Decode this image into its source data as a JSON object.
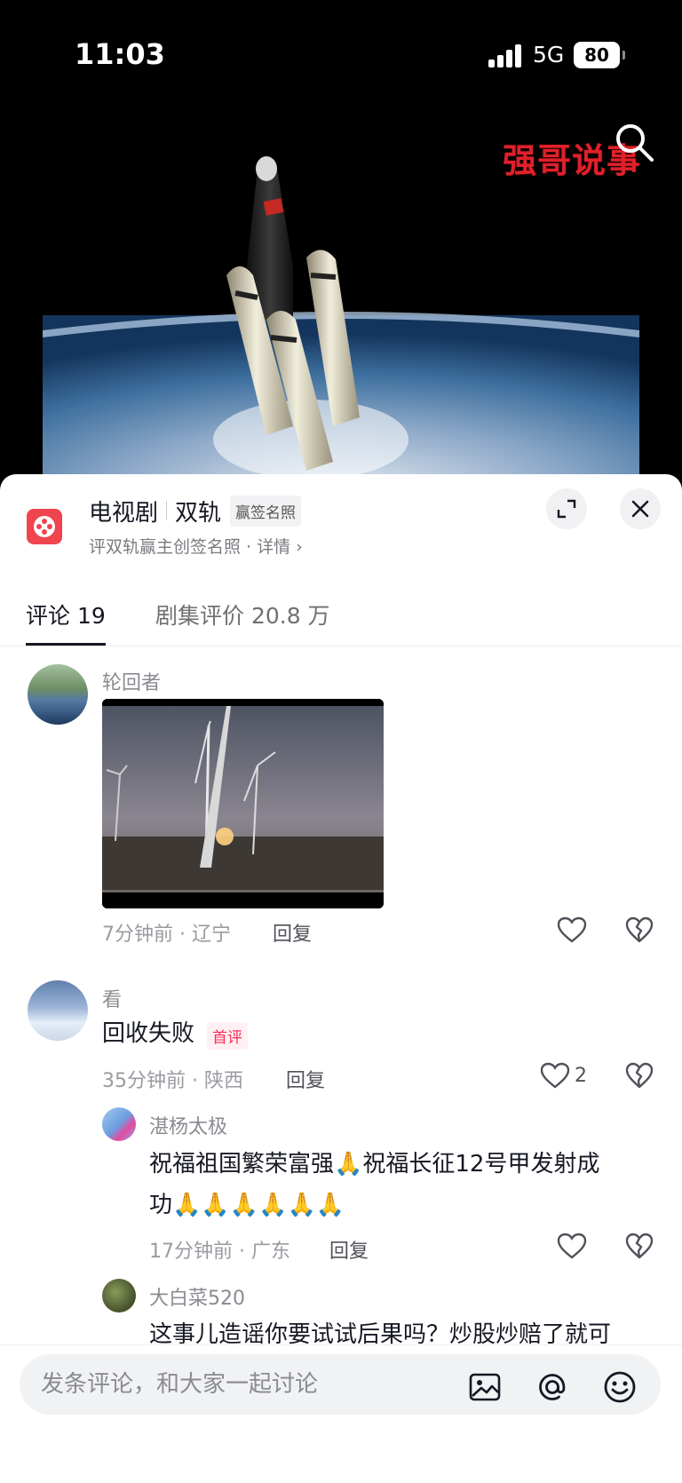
{
  "status_bar": {
    "time": "11:03",
    "network": "5G",
    "battery": "80"
  },
  "video": {
    "watermark": "强哥说事"
  },
  "header": {
    "category": "电视剧",
    "show_name": "双轨",
    "chip": "赢签名照",
    "subtitle": "评双轨赢主创签名照 · 详情 ›"
  },
  "tabs": [
    {
      "label": "评论 19"
    },
    {
      "label": "剧集评价 20.8 万"
    }
  ],
  "comments": [
    {
      "user": "轮回者",
      "meta": "7分钟前 · 辽宁",
      "reply": "回复"
    },
    {
      "user": "看",
      "text": "回收失败",
      "badge": "首评",
      "meta": "35分钟前 · 陕西",
      "reply": "回复",
      "likes": "2"
    }
  ],
  "replies": [
    {
      "user": "湛杨太极",
      "text_line1": "祝福祖国繁荣富强🙏祝福长征12号甲发射成",
      "text_line2": "功🙏🙏🙏🙏🙏🙏",
      "meta": "17分钟前 · 广东",
      "reply": "回复"
    },
    {
      "user": "大白菜520",
      "text_line1": "这事儿造谣你要试试后果吗？炒股炒赔了就可"
    }
  ],
  "composer": {
    "placeholder": "发条评论，和大家一起讨论"
  },
  "colors": {
    "accent": "#fe2c55",
    "tag_icon": "#f0444e",
    "watermark": "#e0202a"
  }
}
